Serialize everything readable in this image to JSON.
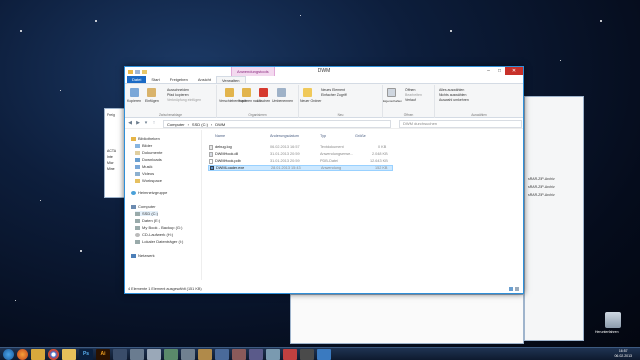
{
  "window": {
    "title": "DWM",
    "context_tab": "Anwendungstools",
    "controls": {
      "minimize": "–",
      "maximize": "□",
      "close": "✕"
    }
  },
  "ribbon_tabs": [
    "Datei",
    "Start",
    "Freigeben",
    "Ansicht",
    "Verwalten"
  ],
  "ribbon": {
    "clipboard": {
      "label": "Zwischenablage",
      "copy": "Kopieren",
      "paste": "Einfügen",
      "cut": "Ausschneiden",
      "copy_path": "Pfad kopieren",
      "paste_link": "Verknüpfung einfügen"
    },
    "organize": {
      "label": "Organisieren",
      "move": "Verschieben nach",
      "copy_to": "Kopieren nach",
      "delete": "Löschen",
      "rename": "Umbenennen"
    },
    "new": {
      "label": "Neu",
      "new_folder": "Neuer Ordner",
      "new_item": "Neues Element",
      "easy_access": "Einfacher Zugriff"
    },
    "open": {
      "label": "Öffnen",
      "properties": "Eigenschaften",
      "open": "Öffnen",
      "edit": "Bearbeiten",
      "history": "Verlauf"
    },
    "select": {
      "label": "Auswählen",
      "select_all": "Alles auswählen",
      "select_none": "Nichts auswählen",
      "invert": "Auswahl umkehren"
    }
  },
  "address": {
    "path": [
      "Computer",
      "SSD (C:)",
      "DWM"
    ],
    "search_placeholder": "DWM durchsuchen"
  },
  "nav": {
    "libraries": "Bibliotheken",
    "lib_items": [
      "Bilder",
      "Dokumente",
      "Downloads",
      "Musik",
      "Videos",
      "Workspace"
    ],
    "homegroup": "Heimnetzgruppe",
    "computer": "Computer",
    "drives": [
      "SSD (C:)",
      "Daten (E:)",
      "My Book - Backup (G:)",
      "CD-Laufwerk (H:)",
      "Lokaler Datenträger (I:)"
    ],
    "network": "Netzwerk"
  },
  "columns": {
    "name": "Name",
    "date": "Änderungsdatum",
    "type": "Typ",
    "size": "Größe"
  },
  "files": [
    {
      "name": "debug.log",
      "date": "06.02.2013 16:57",
      "type": "Textdokument",
      "size": "0 KB"
    },
    {
      "name": "DWMHook.dll",
      "date": "31.01.2013 20:59",
      "type": "Anwendungserwe...",
      "size": "2.048 KB"
    },
    {
      "name": "DWMHook.pdb",
      "date": "31.01.2013 20:59",
      "type": "PDB-Datei",
      "size": "12.643 KB"
    },
    {
      "name": "DWMLoader.exe",
      "date": "28.01.2013 15:43",
      "type": "Anwendung",
      "size": "152 KB"
    }
  ],
  "status": "4 Elemente     1 Element ausgewählt (151 KB)",
  "taskbar": {
    "time": "16:57",
    "date": "06.02.2013"
  },
  "desktop": {
    "recycle_label": "Herunterfahren",
    "bg_files": [
      "sRAR-ZIP-Archiv",
      "sRAR-ZIP-Archiv",
      "sRAR-ZIP-Archiv"
    ]
  },
  "colors": {
    "accent": "#1a6ac5",
    "selection": "#cce8ff",
    "close": "#c7312a",
    "context": "#8b2a7f"
  }
}
